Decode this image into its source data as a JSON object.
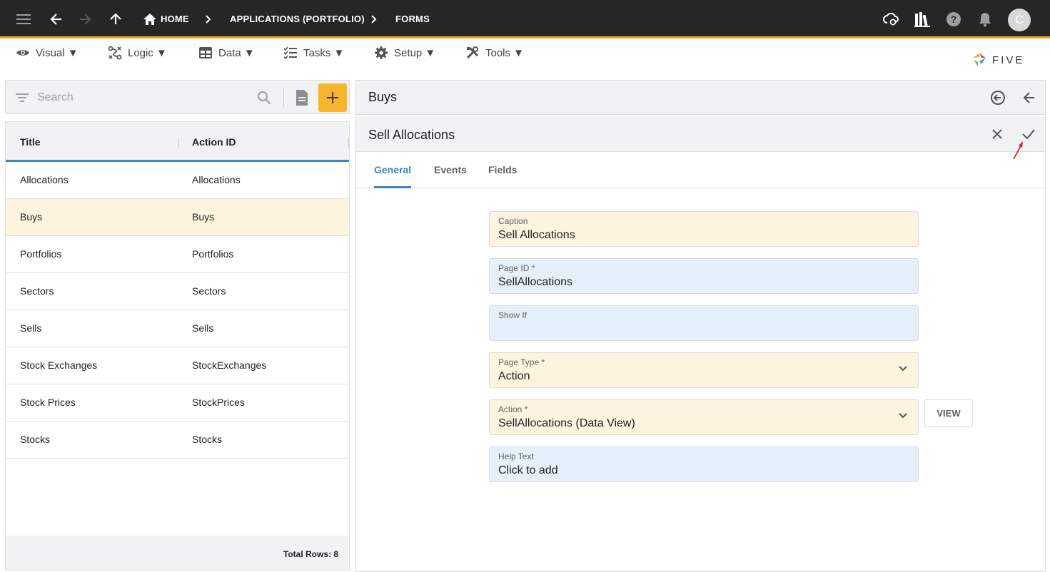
{
  "topbar": {
    "breadcrumbs": [
      "HOME",
      "APPLICATIONS (PORTFOLIO)",
      "FORMS"
    ],
    "avatar_initial": "C"
  },
  "menu": {
    "items": [
      {
        "label": "Visual ▼",
        "icon": "eye-icon"
      },
      {
        "label": "Logic ▼",
        "icon": "logic-icon"
      },
      {
        "label": "Data ▼",
        "icon": "table-icon"
      },
      {
        "label": "Tasks ▼",
        "icon": "tasks-icon"
      },
      {
        "label": "Setup ▼",
        "icon": "gear-icon"
      },
      {
        "label": "Tools ▼",
        "icon": "tools-icon"
      }
    ],
    "logo_text": "FIVE"
  },
  "list": {
    "search_placeholder": "Search",
    "columns": [
      "Title",
      "Action ID"
    ],
    "rows": [
      {
        "title": "Allocations",
        "action_id": "Allocations"
      },
      {
        "title": "Buys",
        "action_id": "Buys"
      },
      {
        "title": "Portfolios",
        "action_id": "Portfolios"
      },
      {
        "title": "Sectors",
        "action_id": "Sectors"
      },
      {
        "title": "Sells",
        "action_id": "Sells"
      },
      {
        "title": "Stock Exchanges",
        "action_id": "StockExchanges"
      },
      {
        "title": "Stock Prices",
        "action_id": "StockPrices"
      },
      {
        "title": "Stocks",
        "action_id": "Stocks"
      }
    ],
    "total_rows": "Total Rows: 8"
  },
  "detail": {
    "title": "Buys",
    "sub_title": "Sell Allocations",
    "tabs": [
      "General",
      "Events",
      "Fields"
    ],
    "fields": {
      "caption": {
        "label": "Caption",
        "value": "Sell Allocations"
      },
      "page_id": {
        "label": "Page ID *",
        "value": "SellAllocations"
      },
      "show_if": {
        "label": "Show If",
        "value": ""
      },
      "page_type": {
        "label": "Page Type *",
        "value": "Action"
      },
      "action": {
        "label": "Action *",
        "value": "SellAllocations (Data View)"
      },
      "help_text": {
        "label": "Help Text",
        "value": "Click to add"
      }
    },
    "view_button": "VIEW"
  },
  "colors": {
    "topbar_bg": "#262626",
    "accent_orange": "#f6b52d",
    "accent_blue": "#3a87cc",
    "field_yellow": "#fdf4e0",
    "field_blue": "#e6f0fa",
    "annotation_red": "#e02020"
  }
}
